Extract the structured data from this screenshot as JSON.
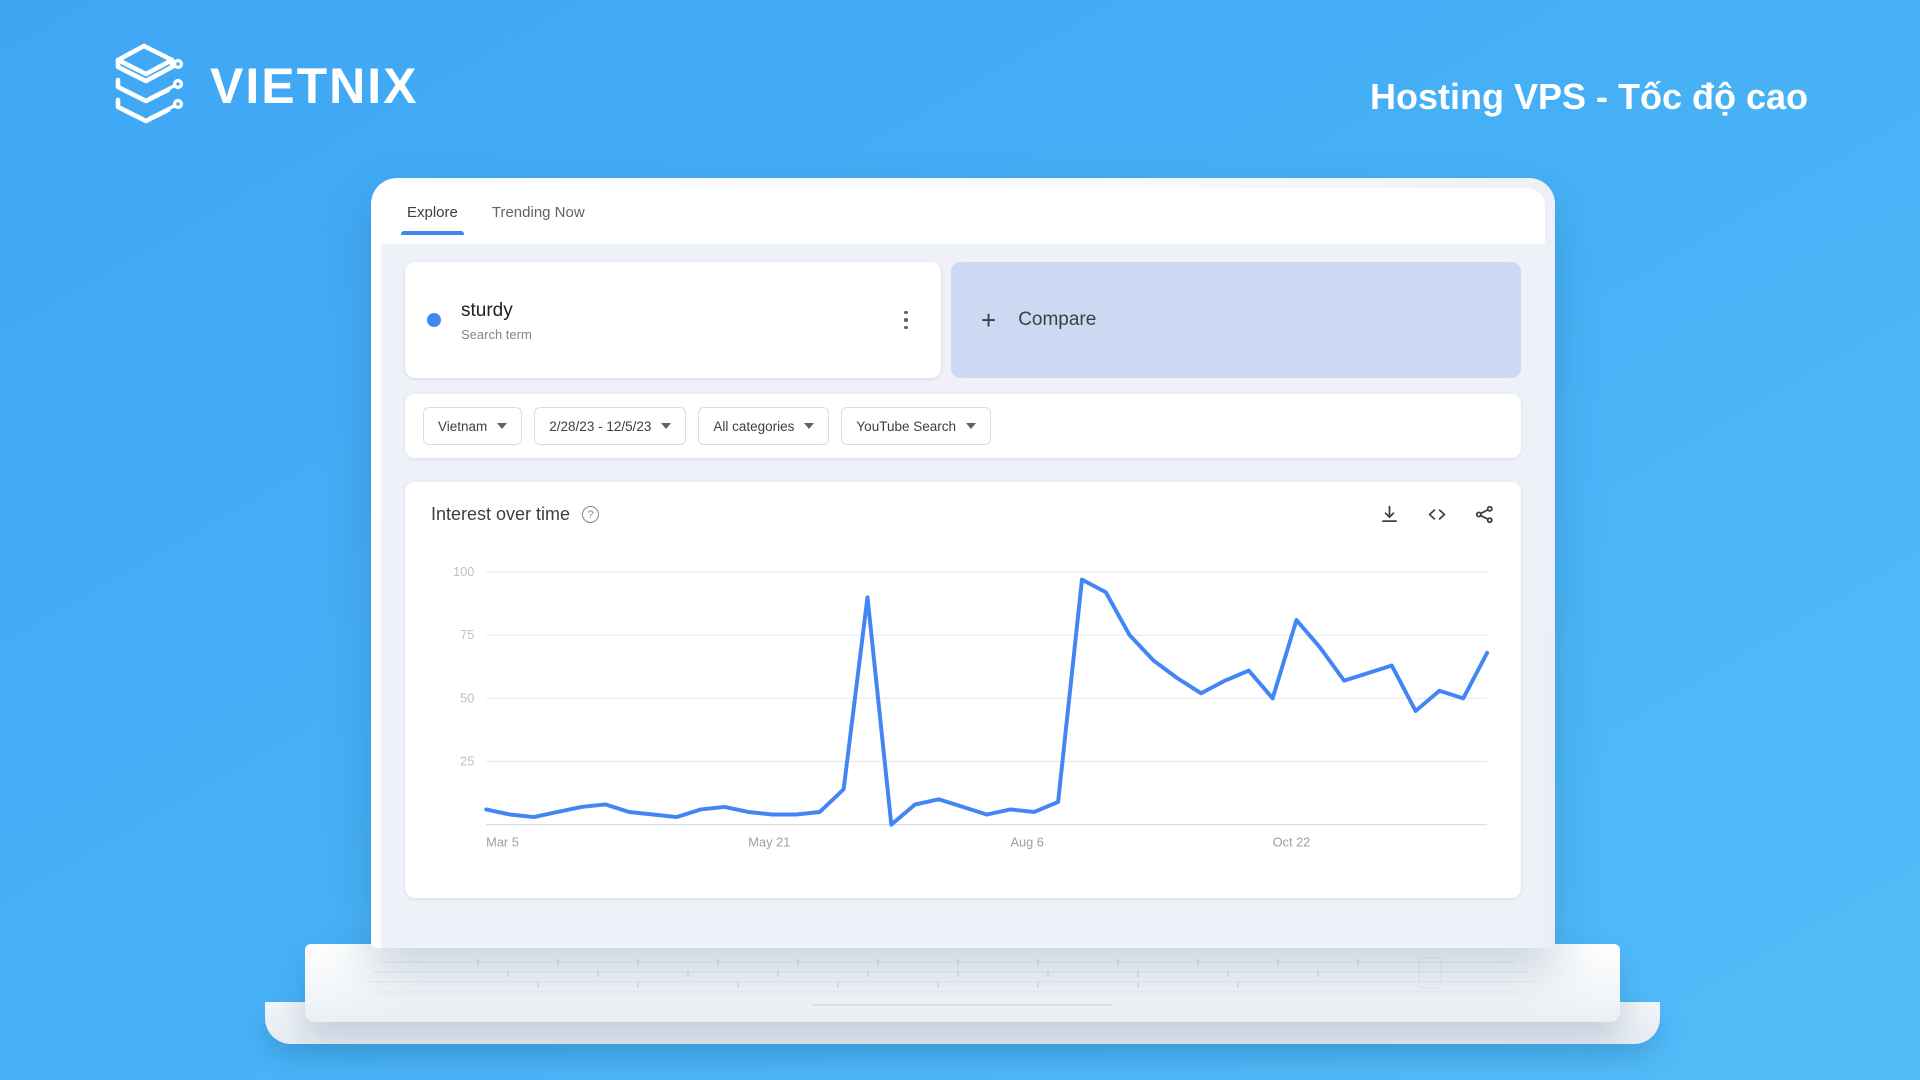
{
  "brand": {
    "name": "VIETNIX",
    "logo_icon": "vietnix-stack-logo",
    "tagline": "Hosting VPS - Tốc độ cao"
  },
  "colors": {
    "background_from": "#3fa6f4",
    "background_to": "#53bdf9",
    "accent_blue": "#4285f4",
    "compare_panel": "#ccd9f2",
    "app_bg": "#eef1f8"
  },
  "app": {
    "tabs": [
      {
        "label": "Explore",
        "active": true
      },
      {
        "label": "Trending Now",
        "active": false
      }
    ],
    "search_term": {
      "term": "sturdy",
      "type_label": "Search term",
      "dot_color": "#4285f4",
      "menu_icon": "more-vertical-icon"
    },
    "compare": {
      "plus_icon": "plus-icon",
      "label": "Compare"
    },
    "filters": [
      {
        "name": "location",
        "label": "Vietnam"
      },
      {
        "name": "date-range",
        "label": "2/28/23 - 12/5/23"
      },
      {
        "name": "category",
        "label": "All categories"
      },
      {
        "name": "search-type",
        "label": "YouTube Search"
      }
    ],
    "chart_panel": {
      "title": "Interest over time",
      "help_icon": "help-circle-icon",
      "actions": [
        {
          "name": "download-icon",
          "title": "Download"
        },
        {
          "name": "embed-code-icon",
          "title": "Embed"
        },
        {
          "name": "share-icon",
          "title": "Share"
        }
      ]
    }
  },
  "chart_data": {
    "type": "line",
    "title": "Interest over time",
    "xlabel": "",
    "ylabel": "",
    "ylim": [
      0,
      110
    ],
    "yticks": [
      25,
      50,
      75,
      100
    ],
    "ytick_labels": [
      "25",
      "50",
      "75",
      "100"
    ],
    "grid": true,
    "legend": false,
    "line_color": "#4285f4",
    "xtick_labels": [
      "Mar 5",
      "May 21",
      "Aug 6",
      "Oct 22"
    ],
    "xtick_indices": [
      0,
      11,
      22,
      33
    ],
    "series": [
      {
        "name": "sturdy",
        "values": [
          6,
          4,
          3,
          5,
          7,
          8,
          5,
          4,
          3,
          6,
          7,
          5,
          4,
          4,
          5,
          14,
          90,
          0,
          8,
          10,
          7,
          4,
          6,
          5,
          9,
          97,
          92,
          75,
          65,
          58,
          52,
          57,
          61,
          50,
          81,
          70,
          57,
          60,
          63,
          45,
          53,
          50,
          68
        ]
      }
    ]
  }
}
